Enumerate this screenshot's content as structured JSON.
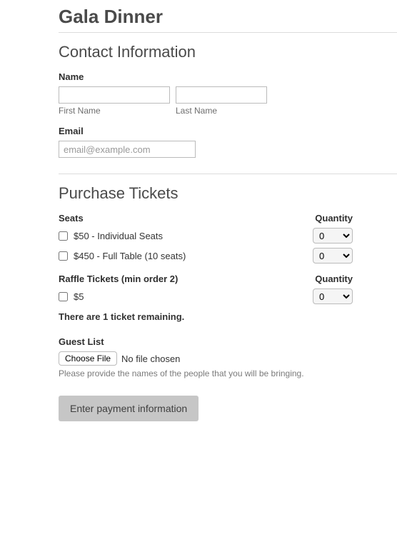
{
  "page_title": "Gala Dinner",
  "contact": {
    "heading": "Contact Information",
    "name_label": "Name",
    "first_name_value": "",
    "first_name_sub": "First Name",
    "last_name_value": "",
    "last_name_sub": "Last Name",
    "email_label": "Email",
    "email_placeholder": "email@example.com",
    "email_value": ""
  },
  "tickets": {
    "heading": "Purchase Tickets",
    "seats_label": "Seats",
    "quantity_label": "Quantity",
    "seat_items": [
      {
        "label": "$50 - Individual Seats",
        "checked": false,
        "qty": "0"
      },
      {
        "label": "$450 - Full Table (10 seats)",
        "checked": false,
        "qty": "0"
      }
    ],
    "raffle_label": "Raffle Tickets (min order 2)",
    "raffle_items": [
      {
        "label": "$5",
        "checked": false,
        "qty": "0"
      }
    ],
    "remaining_text": "There are 1 ticket remaining."
  },
  "guest": {
    "label": "Guest List",
    "file_button": "Choose File",
    "file_status": "No file chosen",
    "help": "Please provide the names of the people that you will be bringing."
  },
  "submit_label": "Enter payment information"
}
